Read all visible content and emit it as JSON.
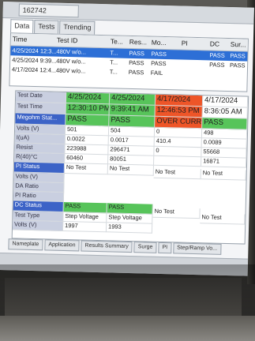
{
  "window": {
    "record_id": "162742"
  },
  "tabs": [
    "Data",
    "Tests",
    "Trending"
  ],
  "list": {
    "headers": {
      "time": "Time",
      "test_id": "Test ID",
      "te": "Te...",
      "res": "Res...",
      "mo": "Mo...",
      "pi": "PI",
      "dc": "DC",
      "sur": "Sur..."
    },
    "rows": [
      {
        "time": "4/25/2024 12:3...",
        "test_id": "480V w/o...",
        "te": "T...",
        "res": "PASS",
        "mo": "PASS",
        "pi": "",
        "dc": "PASS",
        "sur": "PASS"
      },
      {
        "time": "4/25/2024 9:39...",
        "test_id": "480V w/o...",
        "te": "T...",
        "res": "PASS",
        "mo": "PASS",
        "pi": "",
        "dc": "PASS",
        "sur": "PASS"
      },
      {
        "time": "4/17/2024 12:4...",
        "test_id": "480V w/o...",
        "te": "T...",
        "res": "PASS",
        "mo": "FAIL",
        "pi": "",
        "dc": "",
        "sur": ""
      }
    ]
  },
  "grid": {
    "columns": [
      "4/25/2024",
      "4/25/2024",
      "4/17/2024",
      "4/17/2024"
    ],
    "test_time": [
      "12:30:10 PM",
      "9:39:41 AM",
      "12:46:53 PM",
      "8:36:05 AM"
    ],
    "megohm": [
      "PASS",
      "PASS",
      "OVER CURRE...",
      "PASS"
    ],
    "volts": [
      "501",
      "504",
      "0",
      "498"
    ],
    "ua": [
      "0.0022",
      "0.0017",
      "410.4",
      "0.0089"
    ],
    "resist": [
      "223988",
      "296471",
      "0",
      "55668"
    ],
    "r40": [
      "60460",
      "80051",
      "",
      "16871"
    ],
    "pi_status": [
      "No Test",
      "No Test",
      "No Test",
      "No Test"
    ],
    "dc_status": [
      "PASS",
      "PASS",
      "No Test",
      "No Test"
    ],
    "dc_test_type": [
      "Step Voltage",
      "Step Voltage",
      "",
      ""
    ],
    "dc_volts": [
      "1997",
      "1993",
      "",
      ""
    ],
    "labels": {
      "test_date": "Test Date",
      "test_time": "Test Time",
      "megohm": "Megohm Stat...",
      "volts": "Volts (V)",
      "ua": "I(uA)",
      "resist": "Resist",
      "r40": "R(40)°C",
      "pi_status": "PI Status",
      "pi_volts": "Volts (V)",
      "da_ratio": "DA Ratio",
      "pi_ratio": "PI Ratio",
      "dc_status": "DC Status",
      "dc_test_type": "Test Type",
      "dc_volts": "Volts (V)"
    }
  },
  "bottom_tabs": [
    "Nameplate",
    "Application",
    "Results Summary",
    "Surge",
    "PI",
    "Step/Ramp Vo..."
  ],
  "colors": {
    "pass": "#57c45a",
    "fail": "#ee5528",
    "selection": "#2d6fd6"
  }
}
